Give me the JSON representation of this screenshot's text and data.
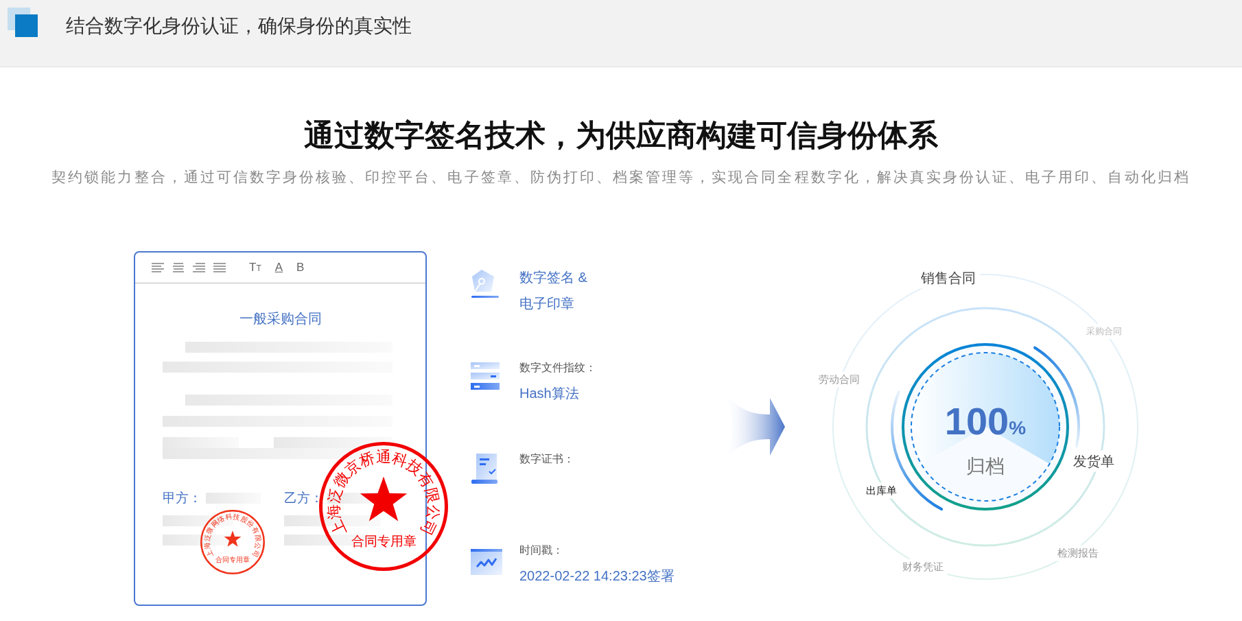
{
  "header": {
    "title": "结合数字化身份认证，确保身份的真实性"
  },
  "hero": {
    "title": "通过数字签名技术，为供应商构建可信身份体系",
    "subtitle": "契约锁能力整合，通过可信数字身份核验、印控平台、电子签章、防伪打印、档案管理等，实现合同全程数字化，解决真实身份认证、电子用印、自动化归档"
  },
  "contract": {
    "toolbar": [
      {
        "kind": "size",
        "label": "TT"
      },
      {
        "kind": "color",
        "label": "A"
      },
      {
        "kind": "bold",
        "label": "B"
      }
    ],
    "title": "一般采购合同",
    "parties": [
      "甲方：",
      "乙方："
    ],
    "stamps": [
      {
        "ring_text": "上海泛微网络科技股份有限公司",
        "center_text": "合同专用章"
      },
      {
        "ring_text": "上海泛微京桥通科技有限公司",
        "center_text": "合同专用章"
      }
    ]
  },
  "features": [
    {
      "kind": "pen",
      "title": "数字签名 & 电子印章"
    },
    {
      "kind": "hash",
      "caption": "数字文件指纹：",
      "title": "Hash算法"
    },
    {
      "kind": "cert",
      "caption": "数字证书："
    },
    {
      "kind": "time",
      "caption": "时间戳：",
      "title": "2022-02-22 14:23:23签署"
    }
  ],
  "archive": {
    "value": "100",
    "unit": "%",
    "label": "归档",
    "documents": [
      {
        "text": "销售合同",
        "kind": "strong"
      },
      {
        "text": "采购合同",
        "kind": "faint"
      },
      {
        "text": "劳动合同",
        "kind": "medium"
      },
      {
        "text": "发货单",
        "kind": "strong"
      },
      {
        "text": "出库单",
        "kind": "dark"
      },
      {
        "text": "检测报告",
        "kind": "medium"
      },
      {
        "text": "财务凭证",
        "kind": "medium"
      }
    ]
  }
}
